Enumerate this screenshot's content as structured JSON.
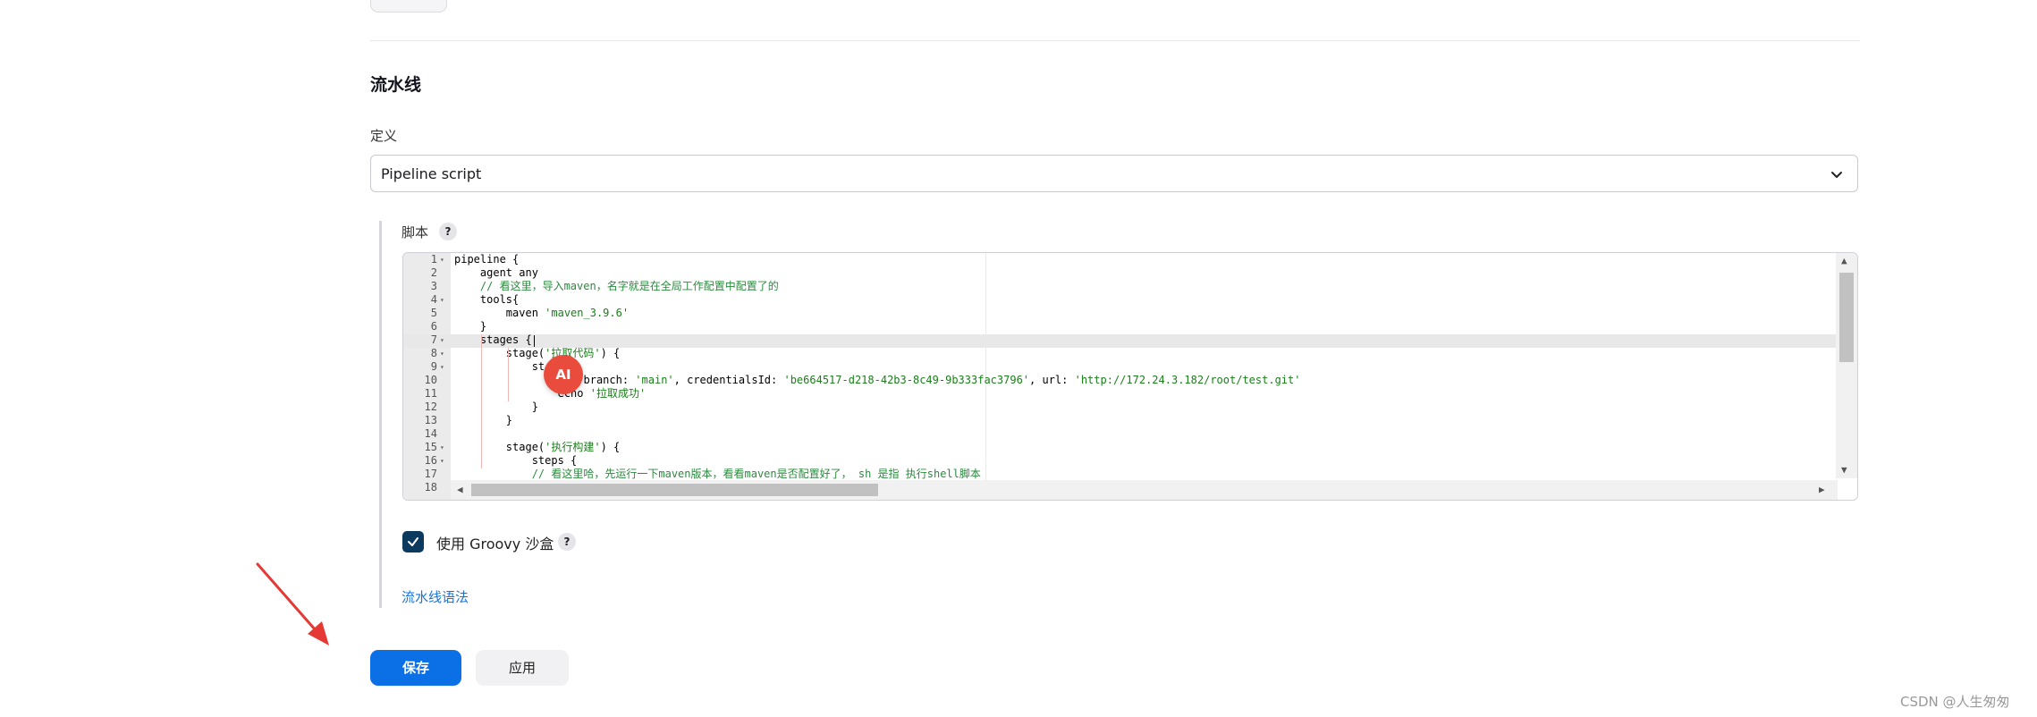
{
  "pipeline": {
    "section_title": "流水线",
    "definition_label": "定义",
    "definition_value": "Pipeline script"
  },
  "script": {
    "label": "脚本",
    "help": "?",
    "lines": [
      {
        "n": "1",
        "fold": "▾",
        "html": "pipeline {"
      },
      {
        "n": "2",
        "fold": "",
        "html": "    agent any"
      },
      {
        "n": "3",
        "fold": "",
        "html": "    <span class=\"tok-com\">// 看这里，导入maven，名字就是在全局工作配置中配置了的</span>"
      },
      {
        "n": "4",
        "fold": "▾",
        "html": "    tools{"
      },
      {
        "n": "5",
        "fold": "",
        "html": "        maven <span class=\"tok-str\">'maven_3.9.6'</span>"
      },
      {
        "n": "6",
        "fold": "",
        "html": "    }"
      },
      {
        "n": "7",
        "fold": "▾",
        "html": "    stages {"
      },
      {
        "n": "8",
        "fold": "▾",
        "html": "        stage(<span class=\"tok-str\">'拉取代码'</span>) {"
      },
      {
        "n": "9",
        "fold": "▾",
        "html": "            st"
      },
      {
        "n": "10",
        "fold": "",
        "html": "                    branch: <span class=\"tok-str\">'main'</span>, credentialsId: <span class=\"tok-str\">'be664517-d218-42b3-8c49-9b333fac3796'</span>, url: <span class=\"tok-str\">'http://172.24.3.182/root/test.git'</span>"
      },
      {
        "n": "11",
        "fold": "",
        "html": "                echo <span class=\"tok-str\">'拉取成功'</span>"
      },
      {
        "n": "12",
        "fold": "",
        "html": "            }"
      },
      {
        "n": "13",
        "fold": "",
        "html": "        }"
      },
      {
        "n": "14",
        "fold": "",
        "html": ""
      },
      {
        "n": "15",
        "fold": "▾",
        "html": "        stage(<span class=\"tok-str\">'执行构建'</span>) {"
      },
      {
        "n": "16",
        "fold": "▾",
        "html": "            steps {"
      },
      {
        "n": "17",
        "fold": "",
        "html": "            <span class=\"tok-com\">// 看这里哈，先运行一下maven版本，看看maven是否配置好了， sh 是指 执行shell脚本</span>"
      },
      {
        "n": "18",
        "fold": "",
        "html": ""
      }
    ]
  },
  "ai_badge": "AI",
  "sandbox": {
    "label": "使用 Groovy 沙盒",
    "checked": true,
    "help": "?"
  },
  "syntax_link": "流水线语法",
  "buttons": {
    "save": "保存",
    "apply": "应用"
  },
  "watermark": "CSDN @人生匆匆",
  "colors": {
    "primary": "#0b6fe6",
    "checkbox": "#0b3a5e",
    "link": "#1a73d9",
    "annotation_arrow": "#e53935"
  }
}
